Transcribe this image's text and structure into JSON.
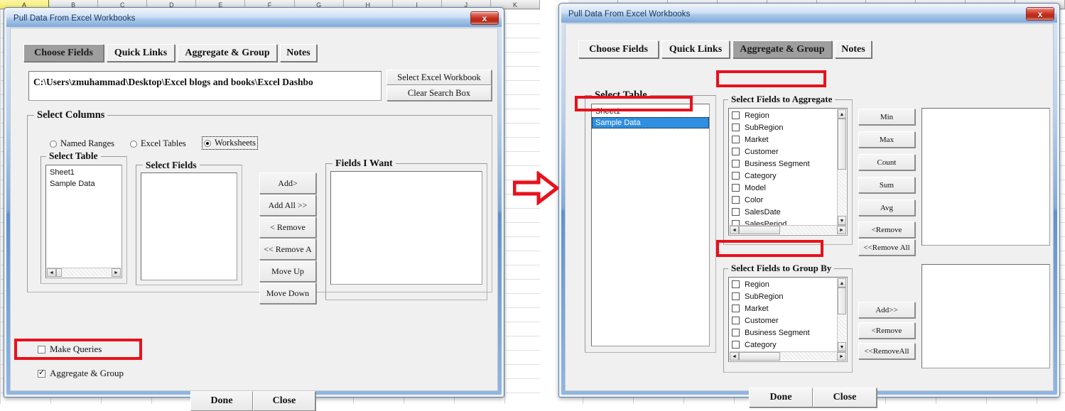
{
  "excel": {
    "columns": [
      "A",
      "B",
      "C",
      "D",
      "E",
      "F",
      "G",
      "H",
      "I",
      "J",
      "K"
    ],
    "selected_column": "A"
  },
  "arrow": {
    "name": "right-arrow-annotation",
    "color": "#e8111b"
  },
  "left_dialog": {
    "title": "Pull Data From Excel Workbooks",
    "close_label": "x",
    "tabs": [
      {
        "label": "Choose Fields",
        "active": true
      },
      {
        "label": "Quick Links",
        "active": false
      },
      {
        "label": "Aggregate & Group",
        "active": false
      },
      {
        "label": "Notes",
        "active": false
      }
    ],
    "path_value": "C:\\Users\\zmuhammad\\Desktop\\Excel blogs and books\\Excel Dashbo",
    "select_workbook_label": "Select Excel Workbook",
    "clear_search_label": "Clear Search Box",
    "select_columns_label": "Select  Columns",
    "radios": [
      {
        "label": "Named Ranges",
        "selected": false
      },
      {
        "label": "Excel Tables",
        "selected": false
      },
      {
        "label": "Worksheets",
        "selected": true
      }
    ],
    "select_table_label": "Select Table",
    "select_table_items": [
      "Sheet1",
      "Sample Data"
    ],
    "select_fields_label": "Select Fields",
    "select_fields_items": [],
    "fields_i_want_label": "Fields I Want",
    "fields_i_want_items": [],
    "transfer_buttons": [
      "Add>",
      "Add All >>",
      "< Remove",
      "<< Remove A",
      "Move Up",
      "Move Down"
    ],
    "checkboxes": [
      {
        "label": "Make Queries",
        "checked": false
      },
      {
        "label": "Aggregate & Group",
        "checked": true
      }
    ],
    "done_label": "Done",
    "close_label_btn": "Close"
  },
  "right_dialog": {
    "title": "Pull Data From Excel Workbooks",
    "close_label": "x",
    "tabs": [
      {
        "label": "Choose Fields",
        "active": false
      },
      {
        "label": "Quick Links",
        "active": false
      },
      {
        "label": "Aggregate & Group",
        "active": true
      },
      {
        "label": "Notes",
        "active": false
      }
    ],
    "select_table_label": "Select Table",
    "select_table_items": [
      {
        "label": "Sheet1",
        "selected": false
      },
      {
        "label": "Sample Data",
        "selected": true
      }
    ],
    "aggregate_label": "Select Fields to Aggregate",
    "aggregate_fields": [
      "Region",
      "SubRegion",
      "Market",
      "Customer",
      "Business Segment",
      "Category",
      "Model",
      "Color",
      "SalesDate",
      "SalesPeriod"
    ],
    "aggregate_buttons": [
      "Min",
      "Max",
      "Count",
      "Sum",
      "Avg",
      "<Remove",
      "<<Remove All"
    ],
    "aggregate_result_items": [],
    "groupby_label": "Select Fields to Group By",
    "groupby_fields": [
      "Region",
      "SubRegion",
      "Market",
      "Customer",
      "Business Segment",
      "Category"
    ],
    "groupby_buttons": [
      "Add>>",
      "<Remove",
      "<<RemoveAll"
    ],
    "groupby_result_items": [],
    "done_label": "Done",
    "close_label_btn": "Close"
  }
}
